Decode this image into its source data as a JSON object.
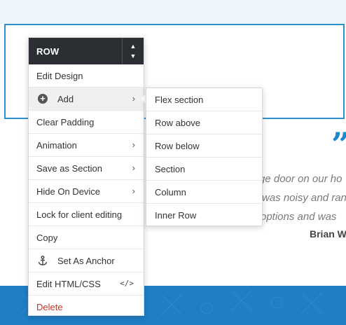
{
  "menu": {
    "header": "ROW",
    "move_up_icon": "caret-up-icon",
    "move_down_icon": "caret-down-icon",
    "items": [
      {
        "label": "Edit Design"
      },
      {
        "label": "Add",
        "icon": "plus-circle-icon"
      },
      {
        "label": "Clear Padding"
      },
      {
        "label": "Animation"
      },
      {
        "label": "Save as Section"
      },
      {
        "label": "Hide On Device"
      },
      {
        "label": "Lock for client editing"
      },
      {
        "label": "Copy"
      },
      {
        "label": "Set As Anchor",
        "icon": "anchor-icon"
      },
      {
        "label": "Edit HTML/CSS",
        "icon": "code-icon"
      },
      {
        "label": "Delete",
        "color": "#c0392b"
      }
    ]
  },
  "submenu": {
    "items": [
      "Flex section",
      "Row above",
      "Row below",
      "Section",
      "Column",
      "Inner Row"
    ]
  },
  "page": {
    "quote_mark": "”",
    "testimonial_lines": [
      "ge door on our ho",
      "was noisy and ran",
      "options and was",
      "",
      ""
    ],
    "author": "Brian W"
  },
  "colors": {
    "accent": "#1f7ec4",
    "menu_header_bg": "#2b2f33",
    "delete": "#c0392b"
  }
}
